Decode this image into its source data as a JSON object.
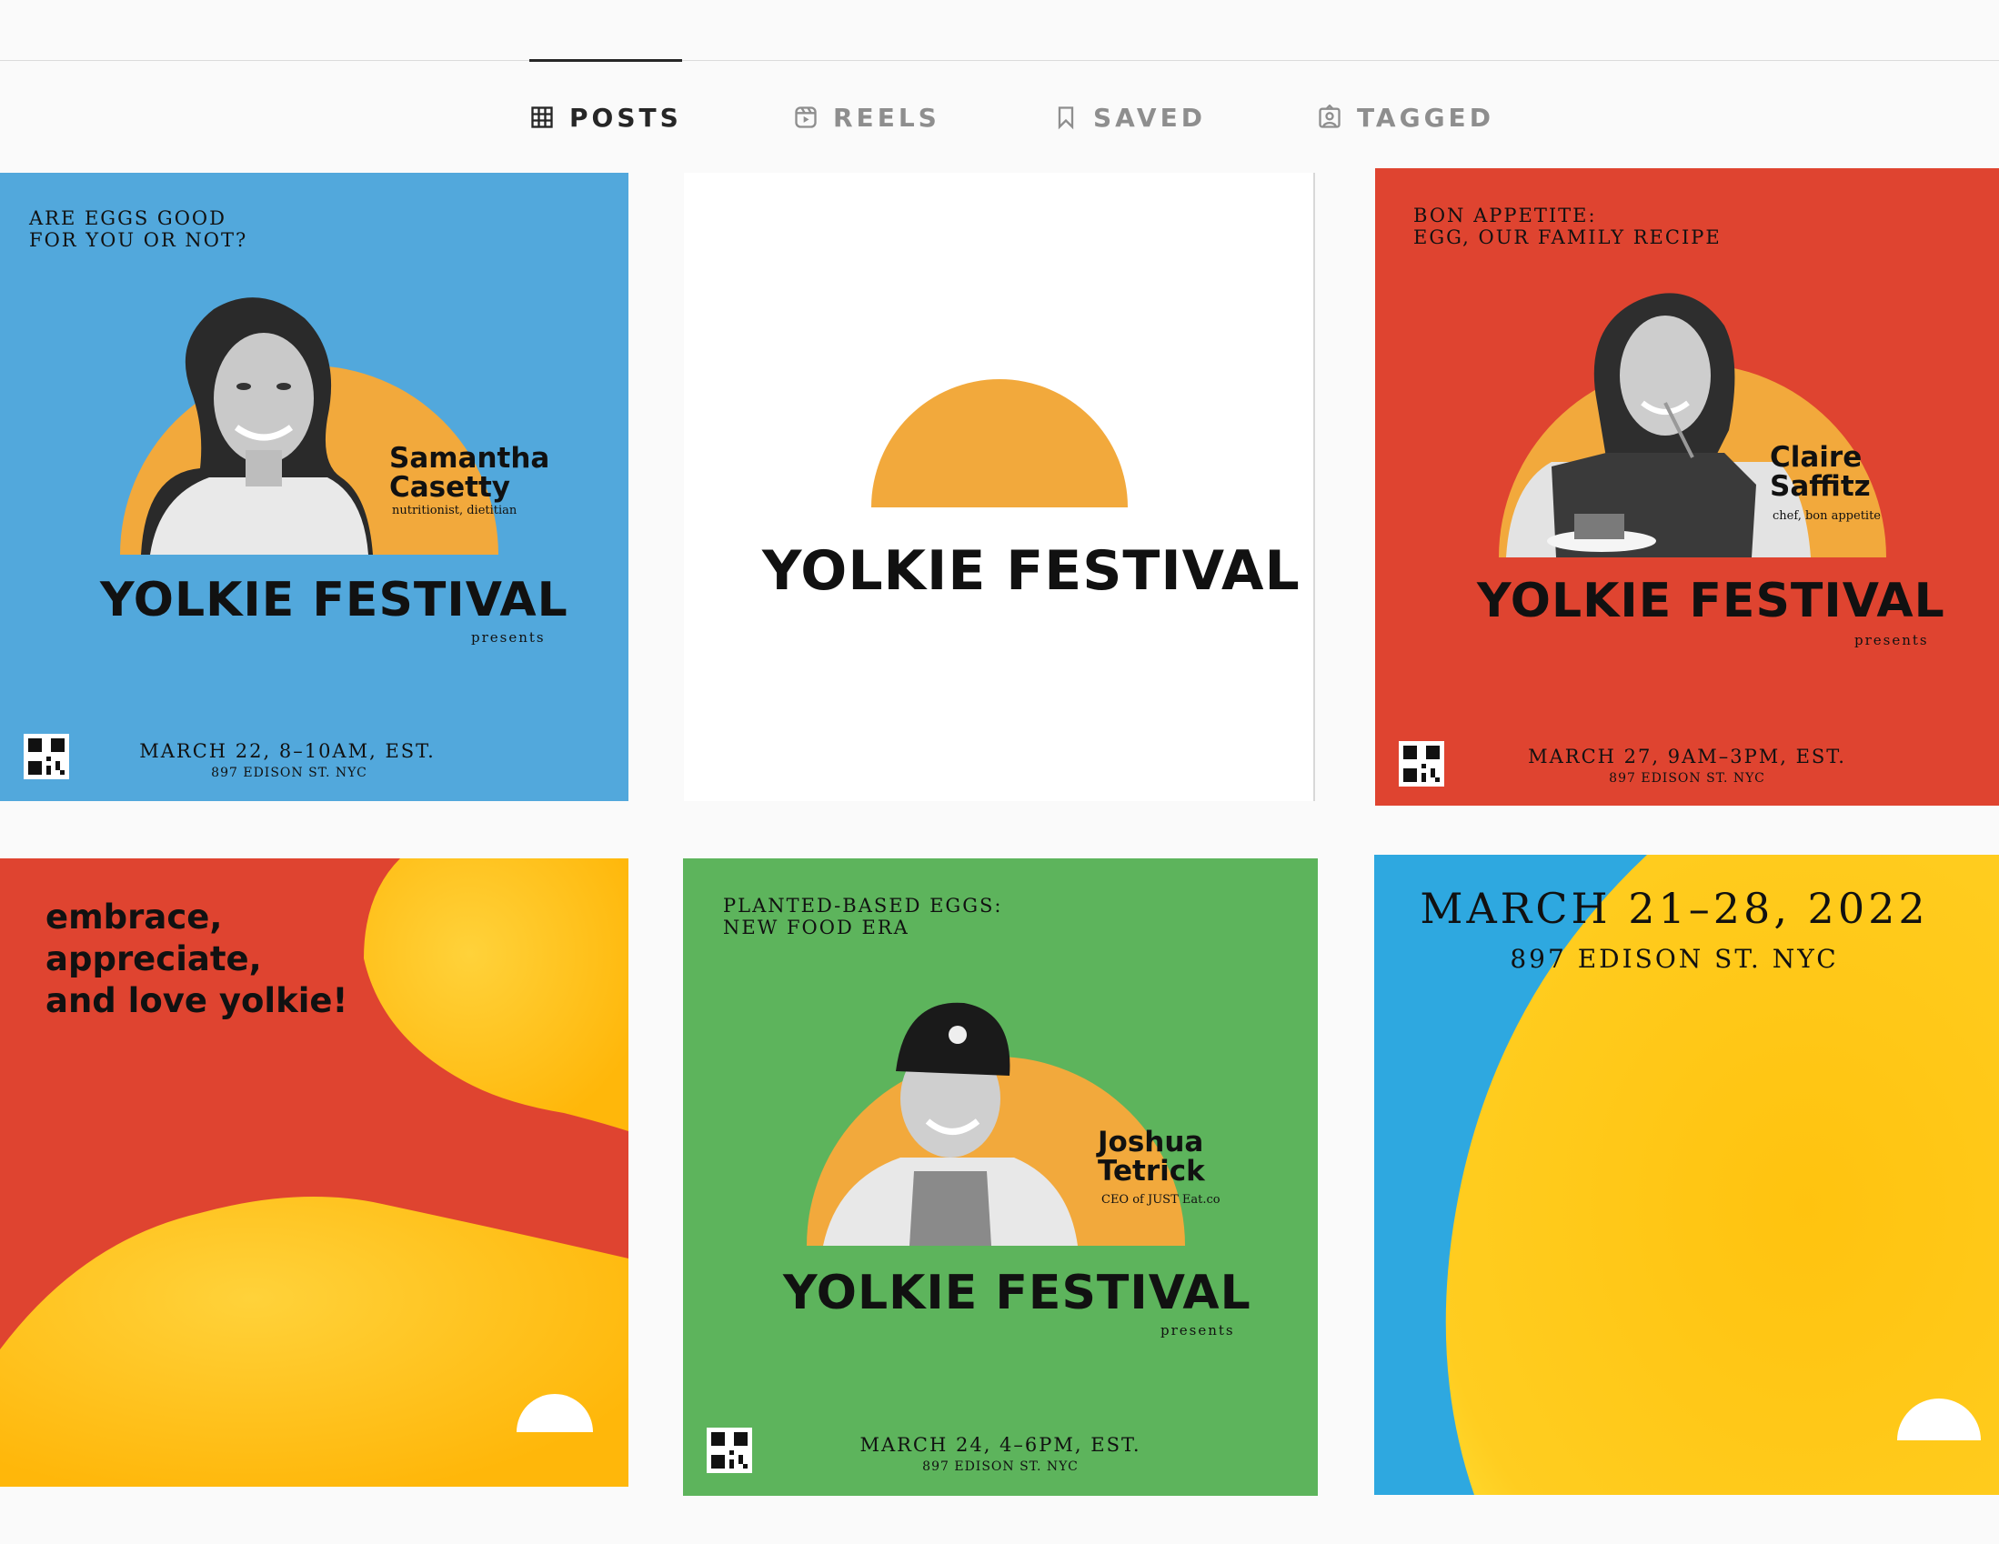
{
  "tabs": [
    {
      "label": "POSTS",
      "icon": "grid-icon",
      "active": true
    },
    {
      "label": "REELS",
      "icon": "reels-icon",
      "active": false
    },
    {
      "label": "SAVED",
      "icon": "bookmark-icon",
      "active": false
    },
    {
      "label": "TAGGED",
      "icon": "tagged-icon",
      "active": false
    }
  ],
  "colors": {
    "blue": "#52a8dc",
    "red": "#df4430",
    "green": "#5db45c",
    "orange": "#f2a93c",
    "yellow": "#ffc30f",
    "sky": "#2ea8e0"
  },
  "posts": {
    "p1": {
      "kicker": [
        "ARE EGGS GOOD",
        "FOR YOU OR NOT?"
      ],
      "name": [
        "Samantha",
        "Casetty"
      ],
      "role": "nutritionist, dietitian",
      "title": "YOLKIE FESTIVAL",
      "presents": "presents",
      "date": "MARCH 22, 8–10AM, EST.",
      "address": "897 EDISON ST. NYC"
    },
    "p2": {
      "title": "YOLKIE FESTIVAL"
    },
    "p3": {
      "kicker": [
        "BON APPETITE:",
        "EGG, OUR FAMILY RECIPE"
      ],
      "name": [
        "Claire",
        "Saffitz"
      ],
      "role": "chef, bon appetite",
      "title": "YOLKIE FESTIVAL",
      "presents": "presents",
      "date": "MARCH 27, 9AM–3PM, EST.",
      "address": "897 EDISON ST. NYC"
    },
    "p4": {
      "slogan": [
        "embrace,",
        "appreciate,",
        "and love yolkie!"
      ]
    },
    "p5": {
      "kicker": [
        "PLANTED-BASED EGGS:",
        "NEW FOOD ERA"
      ],
      "name": [
        "Joshua",
        "Tetrick"
      ],
      "role": "CEO of JUST Eat.co",
      "title": "YOLKIE FESTIVAL",
      "presents": "presents",
      "date": "MARCH 24, 4–6PM, EST.",
      "address": "897 EDISON ST. NYC"
    },
    "p6": {
      "date": "MARCH 21–28, 2022",
      "address": "897 EDISON ST. NYC"
    }
  }
}
